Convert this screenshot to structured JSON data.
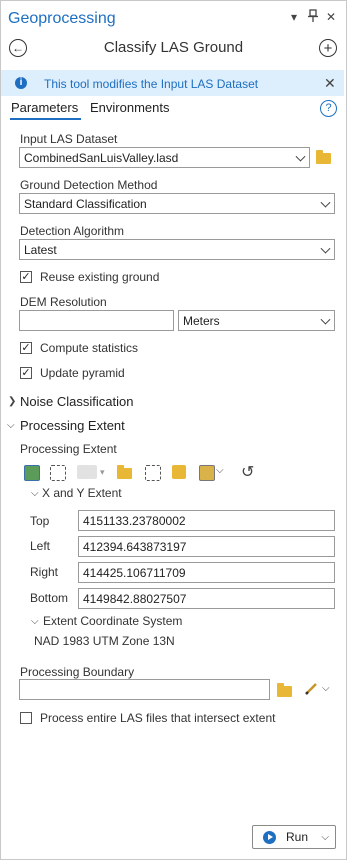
{
  "window": {
    "title": "Geoprocessing",
    "menu_glyph": "▾",
    "pin_glyph": "📌",
    "close_glyph": "✕"
  },
  "tool": {
    "title": "Classify LAS Ground",
    "back_glyph": "←",
    "add_glyph": "+"
  },
  "banner": {
    "text": "This tool modifies the Input LAS Dataset",
    "close_glyph": "✕"
  },
  "tabs": [
    {
      "label": "Parameters",
      "active": true
    },
    {
      "label": "Environments",
      "active": false
    }
  ],
  "help_glyph": "?",
  "params": {
    "input_las": {
      "label": "Input LAS Dataset",
      "value": "CombinedSanLuisValley.lasd"
    },
    "ground_method": {
      "label": "Ground Detection Method",
      "value": "Standard Classification"
    },
    "algorithm": {
      "label": "Detection Algorithm",
      "value": "Latest"
    },
    "reuse_ground": {
      "label": "Reuse existing ground",
      "checked": true
    },
    "dem_resolution": {
      "label": "DEM Resolution",
      "value": "",
      "unit": "Meters"
    },
    "compute_stats": {
      "label": "Compute statistics",
      "checked": true
    },
    "update_pyramid": {
      "label": "Update pyramid",
      "checked": true
    }
  },
  "sections": {
    "noise": {
      "label": "Noise Classification",
      "expanded": false
    },
    "processing_extent": {
      "label": "Processing Extent",
      "expanded": true
    }
  },
  "extent": {
    "label": "Processing Extent",
    "xy_label": "X and Y Extent",
    "top": {
      "label": "Top",
      "value": "4151133.23780002"
    },
    "left": {
      "label": "Left",
      "value": "412394.643873197"
    },
    "right": {
      "label": "Right",
      "value": "414425.106711709"
    },
    "bottom": {
      "label": "Bottom",
      "value": "4149842.88027507"
    },
    "coord_system_label": "Extent Coordinate System",
    "coord_system_value": "NAD 1983 UTM Zone 13N"
  },
  "boundary": {
    "label": "Processing Boundary",
    "value": ""
  },
  "process_entire": {
    "label": "Process entire LAS files that intersect extent",
    "checked": false
  },
  "run": {
    "label": "Run"
  },
  "colors": {
    "accent": "#1e6fc1",
    "banner_bg": "#ddeefc",
    "folder": "#e8b735"
  },
  "icons": [
    "menu-icon",
    "pin-icon",
    "close-icon",
    "back-icon",
    "add-icon",
    "info-icon",
    "help-icon",
    "folder-icon",
    "pencil-icon",
    "run-icon"
  ]
}
